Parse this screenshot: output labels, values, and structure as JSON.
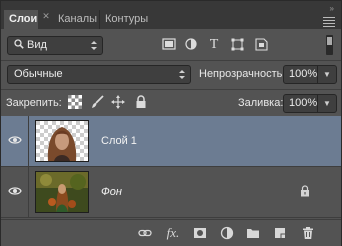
{
  "tabs": [
    {
      "label": "Слои",
      "active": true
    },
    {
      "label": "Каналы",
      "active": false
    },
    {
      "label": "Контуры",
      "active": false
    }
  ],
  "filter": {
    "kind_label": "Вид",
    "icons": [
      "pixel-layer-filter-icon",
      "adjustment-layer-filter-icon",
      "type-layer-filter-icon",
      "shape-layer-filter-icon",
      "smart-object-filter-icon"
    ]
  },
  "blend_mode": "Обычные",
  "opacity": {
    "label": "Непрозрачность:",
    "value": "100%"
  },
  "lock": {
    "label": "Закрепить:"
  },
  "fill": {
    "label": "Заливка:",
    "value": "100%"
  },
  "layers": [
    {
      "name": "Слой 1",
      "selected": true,
      "visible": true,
      "locked": false
    },
    {
      "name": "Фон",
      "selected": false,
      "visible": true,
      "locked": true
    }
  ],
  "colors": {
    "panel_bg": "#535353",
    "tabbar_bg": "#383838",
    "selected_row": "#6c7c92",
    "field_bg": "#3f3f3f"
  }
}
